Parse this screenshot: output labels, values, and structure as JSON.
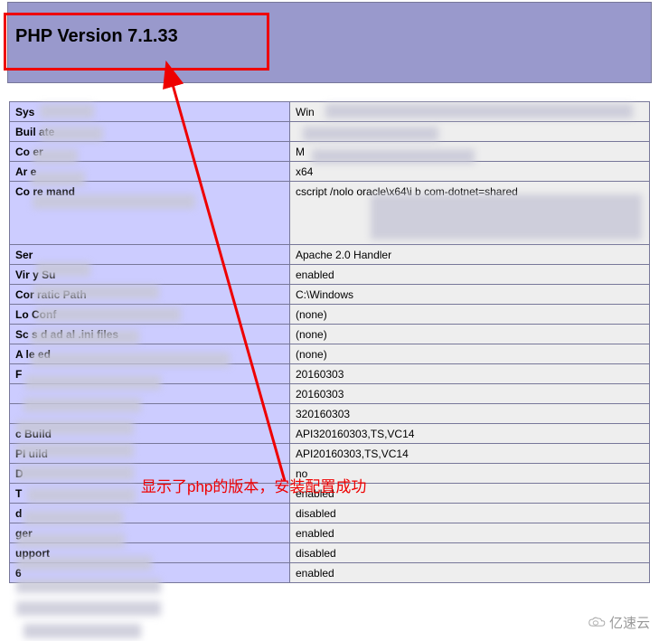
{
  "header": {
    "title": "PHP Version 7.1.33"
  },
  "rows": [
    {
      "key": "Sys",
      "value": "Win"
    },
    {
      "key": "Buil    ate",
      "value": ""
    },
    {
      "key": "Co       er",
      "value": "M"
    },
    {
      "key": "Ar            e",
      "value": "x64"
    },
    {
      "key": "Co       re         mand",
      "value": "cscript /nolo                                         \noracle\\x64\\i\nb\ncom-dotnet=shared",
      "tall": true
    },
    {
      "key": "Ser",
      "value": "Apache 2.0 Handler"
    },
    {
      "key": "Vir                 y Su",
      "value": "enabled"
    },
    {
      "key": "Cor     ratic              Path",
      "value": "C:\\Windows"
    },
    {
      "key": "Lo         Conf",
      "value": "(none)"
    },
    {
      "key": "Sc      s d        ad        al .ini files",
      "value": "(none)"
    },
    {
      "key": "A              le        ed",
      "value": "(none)"
    },
    {
      "key": "F",
      "value": "20160303"
    },
    {
      "key": "",
      "value": "20160303"
    },
    {
      "key": "",
      "value": "320160303"
    },
    {
      "key": "         c                Build",
      "value": "API320160303,TS,VC14"
    },
    {
      "key": "PI                   uild",
      "value": "API20160303,TS,VC14"
    },
    {
      "key": "D",
      "value": "no"
    },
    {
      "key": "T",
      "value": "enabled"
    },
    {
      "key": "                  d",
      "value": "disabled"
    },
    {
      "key": "                     ger",
      "value": "enabled"
    },
    {
      "key": "                 upport",
      "value": "disabled"
    },
    {
      "key": " 6",
      "value": "enabled"
    }
  ],
  "annotation": {
    "caption": "显示了php的版本，安装配置成功"
  },
  "watermark": {
    "text": "亿速云"
  }
}
